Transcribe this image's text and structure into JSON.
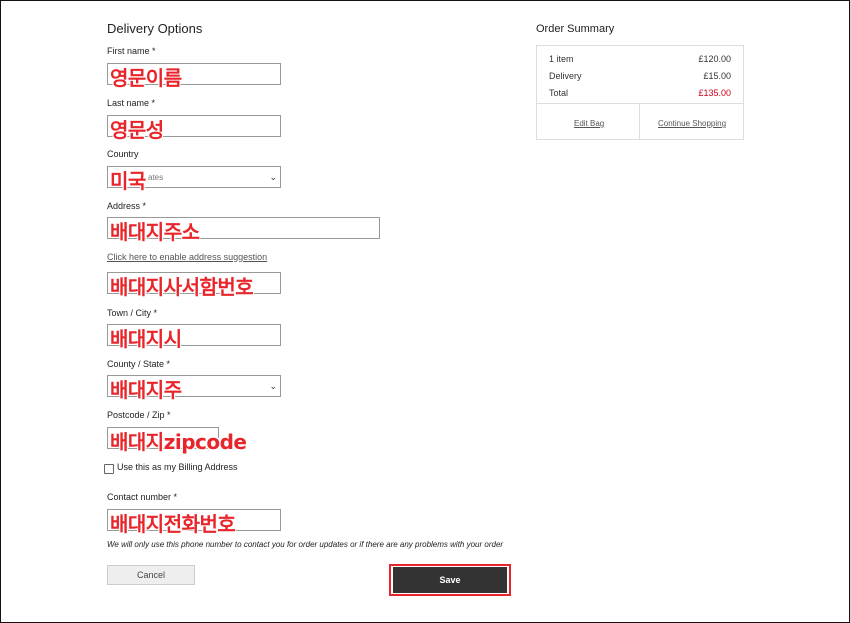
{
  "delivery": {
    "title": "Delivery Options",
    "first_name": {
      "label": "First name *",
      "value": "영문이름"
    },
    "last_name": {
      "label": "Last name *",
      "value": "영문성"
    },
    "country": {
      "label": "Country",
      "selected_partial": "ates",
      "value": "미국"
    },
    "address": {
      "label": "Address *",
      "value": "배대지주소"
    },
    "address_suggestion_link": "Click here to enable address suggestion",
    "address2": {
      "value": "배대지사서함번호"
    },
    "town": {
      "label": "Town / City *",
      "value": "배대지시"
    },
    "county": {
      "label": "County / State *",
      "value": "배대지주"
    },
    "postcode": {
      "label": "Postcode / Zip *",
      "value": "배대지zipcode"
    },
    "billing_checkbox_label": "Use this as my Billing Address",
    "contact": {
      "label": "Contact number *",
      "value": "배대지전화번호"
    },
    "contact_note": "We will only use this phone number to contact you for order updates or if there are any problems with your order",
    "cancel_label": "Cancel",
    "save_label": "Save"
  },
  "order_summary": {
    "title": "Order Summary",
    "rows": [
      {
        "label": "1 item",
        "value": "£120.00"
      },
      {
        "label": "Delivery",
        "value": "£15.00"
      },
      {
        "label": "Total",
        "value": "£135.00"
      }
    ],
    "edit_bag": "Edit Bag",
    "continue_shopping": "Continue Shopping"
  },
  "colors": {
    "annotation_red": "#e8252a",
    "total_red": "#d0021b",
    "save_button": "#333333"
  }
}
